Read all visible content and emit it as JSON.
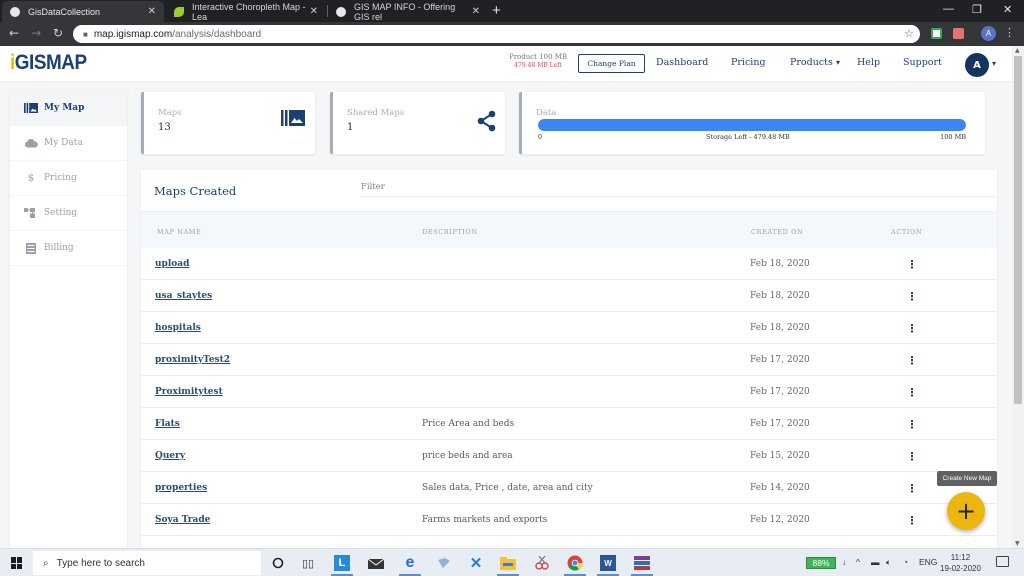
{
  "browser": {
    "tabs": [
      {
        "title": "GisDataCollection",
        "active": true,
        "favicon_color": "#e8e8e8"
      },
      {
        "title": "Interactive Choropleth Map - Lea",
        "active": false,
        "favicon_color": "#9acd32"
      },
      {
        "title": "GIS MAP INFO - Offering GIS rel",
        "active": false,
        "favicon_color": "#e8e8e8"
      }
    ],
    "tab_close": "✕",
    "new_tab": "+",
    "window_controls": {
      "minimize": "—",
      "maximize": "❐",
      "close": "✕"
    },
    "nav": {
      "back": "←",
      "forward": "→",
      "reload": "↻"
    },
    "url_host": "map.igismap.com",
    "url_path": "/analysis/dashboard",
    "profile_initial": "A",
    "menu": "⋮",
    "star": "☆",
    "lock": "🔒"
  },
  "header": {
    "logo_i": "i",
    "logo_rest": "GISMAP",
    "plan_label": "Product 100 MB",
    "plan_left": "479.48 MB Left",
    "change_plan": "Change Plan",
    "nav": [
      {
        "label": "Dashboard"
      },
      {
        "label": "Pricing"
      },
      {
        "label": "Products",
        "caret": "▾"
      },
      {
        "label": "Help"
      },
      {
        "label": "Support"
      }
    ],
    "avatar_initial": "A",
    "avatar_caret": "▾"
  },
  "sidebar": {
    "items": [
      {
        "label": "My Map",
        "icon": "map-gallery-icon",
        "active": true
      },
      {
        "label": "My Data",
        "icon": "cloud-icon",
        "active": false
      },
      {
        "label": "Pricing",
        "icon": "dollar-icon",
        "glyph": "$",
        "active": false
      },
      {
        "label": "Setting",
        "icon": "settings-icon",
        "active": false
      },
      {
        "label": "Billing",
        "icon": "billing-icon",
        "active": false
      }
    ]
  },
  "stats": {
    "maps": {
      "label": "Maps",
      "value": "13"
    },
    "shared": {
      "label": "Shared Maps",
      "value": "1"
    },
    "data": {
      "label": "Data",
      "bar_min": "0",
      "bar_text": "Storage Left - 479.48 MB",
      "bar_max": "100 MB",
      "fill_percent": 100,
      "fill_color": "#3e86f5"
    }
  },
  "maps_table": {
    "title": "Maps Created",
    "filter_placeholder": "Filter",
    "columns": [
      "MAP NAME",
      "DESCRIPTION",
      "CREATED ON",
      "ACTION"
    ],
    "action_glyph": "⋮",
    "rows": [
      {
        "name": "upload",
        "description": "",
        "created": "Feb 18, 2020"
      },
      {
        "name": "usa_staytes",
        "description": "",
        "created": "Feb 18, 2020"
      },
      {
        "name": "hospitals",
        "description": "",
        "created": "Feb 18, 2020"
      },
      {
        "name": "proximityTest2",
        "description": "",
        "created": "Feb 17, 2020"
      },
      {
        "name": "Proximitytest",
        "description": "",
        "created": "Feb 17, 2020"
      },
      {
        "name": "Flats",
        "description": "Price Area and beds",
        "created": "Feb 17, 2020"
      },
      {
        "name": "Query",
        "description": "price beds and area",
        "created": "Feb 15, 2020"
      },
      {
        "name": "properties",
        "description": "Sales data, Price , date, area and city",
        "created": "Feb 14, 2020"
      },
      {
        "name": "Soya Trade",
        "description": "Farms markets and exports",
        "created": "Feb 12, 2020"
      }
    ]
  },
  "fab": {
    "tooltip": "Create New Map",
    "glyph": "+",
    "color": "#ecb60f"
  },
  "taskbar": {
    "search_placeholder": "Type here to search",
    "battery": "88%",
    "language": "ENG",
    "time": "11:12",
    "date": "19-02-2020",
    "tray_caret": "^"
  }
}
